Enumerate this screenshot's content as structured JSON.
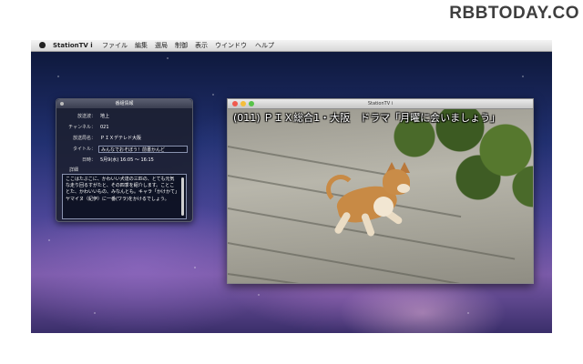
{
  "watermark": "RBBTODAY.CO",
  "menubar": {
    "app_name": "StationTV i",
    "items": [
      "ファイル",
      "編集",
      "選局",
      "制御",
      "表示",
      "ウインドウ",
      "ヘルプ"
    ]
  },
  "info_window": {
    "title": "番組情報",
    "fields": [
      {
        "label": "放送波：",
        "value": "地上"
      },
      {
        "label": "チャンネル：",
        "value": "021"
      },
      {
        "label": "放送局名：",
        "value": "ＰＩＸデテレド大阪"
      },
      {
        "label": "タイトル：",
        "value": "みんなでおそぼう！前書かんど"
      },
      {
        "label": "日時：",
        "value": "5月9(水) 16:05 ～ 16:15"
      }
    ],
    "detail_label": "詳細",
    "detail_text": "ここはたぶこに、かわいい犬達の三匹の、とても元気な走り回るすがたと、その四季を紹介します。ことことた、かわいいもの、みなんとも。キャラ「かけかて」ヤマイヌ（紀伊）に一番(ワラ)をかけるでしょう。"
  },
  "video_window": {
    "title": "StationTV i",
    "subtitle": "(011) ＰＩＸ総合1・大阪　ドラマ「月曜に会いましょう」"
  },
  "colors": {
    "close": "#f05a4e",
    "minimize": "#f5be3b",
    "zoom": "#58c34a"
  }
}
